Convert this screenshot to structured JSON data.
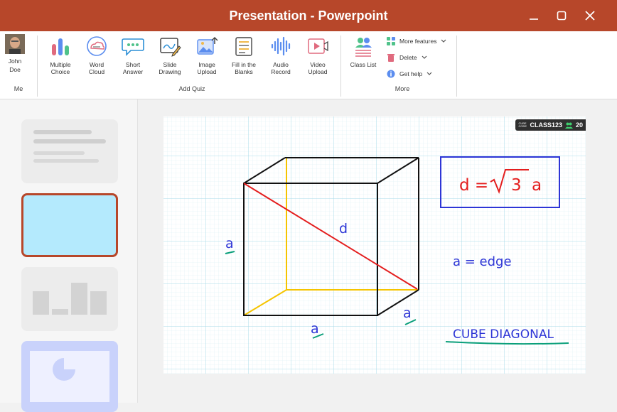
{
  "window": {
    "title": "Presentation - Powerpoint"
  },
  "user": {
    "first_name": "John",
    "last_name": "Doe",
    "group_label": "Me"
  },
  "ribbon": {
    "add_quiz_label": "Add Quiz",
    "more_label": "More",
    "buttons": [
      {
        "line1": "Multiple",
        "line2": "Choice"
      },
      {
        "line1": "Word",
        "line2": "Cloud"
      },
      {
        "line1": "Short",
        "line2": "Answer"
      },
      {
        "line1": "Slide",
        "line2": "Drawing"
      },
      {
        "line1": "Image",
        "line2": "Upload"
      },
      {
        "line1": "Fill in the",
        "line2": "Blanks"
      },
      {
        "line1": "Audio",
        "line2": "Record"
      },
      {
        "line1": "Video",
        "line2": "Upload"
      }
    ],
    "class_list": "Class List",
    "more_items": {
      "more_features": "More features",
      "delete": "Delete",
      "get_help": "Get help"
    }
  },
  "badge": {
    "cube_code": "CUBE CODE",
    "class_code": "CLASS123",
    "count": "20"
  },
  "slide": {
    "formula_lhs": "d =",
    "formula_radicand": "3",
    "formula_var": "a",
    "diagonal_label": "d",
    "edge_label": "a",
    "edge_definition": "a = edge",
    "caption": "CUBE DIAGONAL"
  },
  "colors": {
    "accent": "#b7472a",
    "ink_blue": "#2d35d6",
    "ink_red": "#e41e1e",
    "grid": "#a9dbe9",
    "cube_hidden": "#f5c400",
    "underline": "#0a9f7a"
  }
}
